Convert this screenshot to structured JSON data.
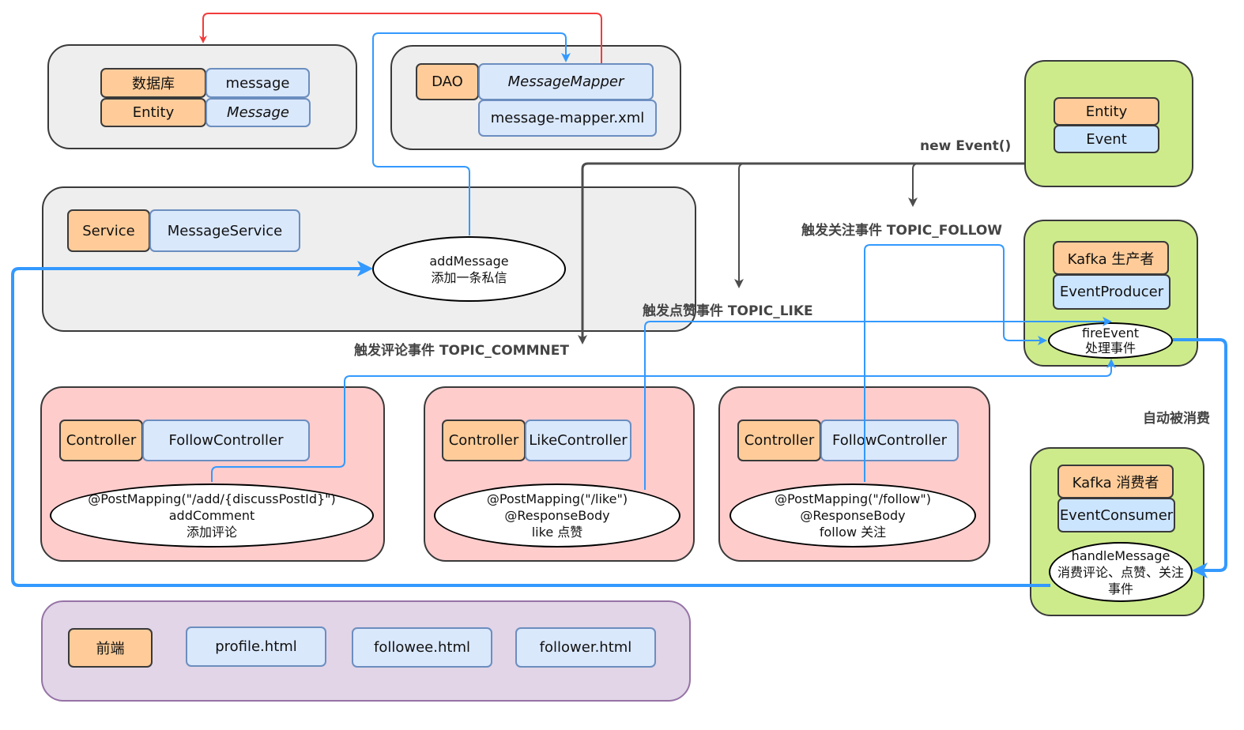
{
  "database_group": {
    "rows": [
      {
        "label": "数据库",
        "value": "message"
      },
      {
        "label": "Entity",
        "value": "Message"
      }
    ]
  },
  "dao_group": {
    "label": "DAO",
    "mapper": "MessageMapper",
    "xml": "message-mapper.xml"
  },
  "service_group": {
    "label": "Service",
    "name": "MessageService",
    "method": {
      "line1": "addMessage",
      "line2": "添加一条私信"
    }
  },
  "event_entity_group": {
    "label": "Entity",
    "name": "Event"
  },
  "producer_group": {
    "label": "Kafka 生产者",
    "name": "EventProducer",
    "method": {
      "line1": "fireEvent",
      "line2": "处理事件"
    }
  },
  "consumer_group": {
    "label": "Kafka 消费者",
    "name": "EventConsumer",
    "method": {
      "line1": "handleMessage",
      "line2": "消费评论、点赞、关注",
      "line3": "事件"
    }
  },
  "controllers": [
    {
      "label": "Controller",
      "name": "FollowController",
      "method": {
        "line1": "@PostMapping(\"/add/{discussPostId}\")",
        "line2": "addComment",
        "line3": "添加评论"
      }
    },
    {
      "label": "Controller",
      "name": "LikeController",
      "method": {
        "line1": "@PostMapping(\"/like\")",
        "line2": "@ResponseBody",
        "line3": "like 点赞"
      }
    },
    {
      "label": "Controller",
      "name": "FollowController",
      "method": {
        "line1": "@PostMapping(\"/follow\")",
        "line2": "@ResponseBody",
        "line3": "follow 关注"
      }
    }
  ],
  "frontend_group": {
    "label": "前端",
    "pages": [
      "profile.html",
      "followee.html",
      "follower.html"
    ]
  },
  "edge_labels": {
    "new_event": "new Event()",
    "topic_follow": "触发关注事件  TOPIC_FOLLOW",
    "topic_like": "触发点赞事件  TOPIC_LIKE",
    "topic_comment": "触发评论事件  TOPIC_COMMNET",
    "auto_consume": "自动被消费"
  },
  "colors": {
    "red_edge": "#f23b3b",
    "blue_edge": "#3399ff",
    "dark_edge": "#4d4d4d"
  }
}
